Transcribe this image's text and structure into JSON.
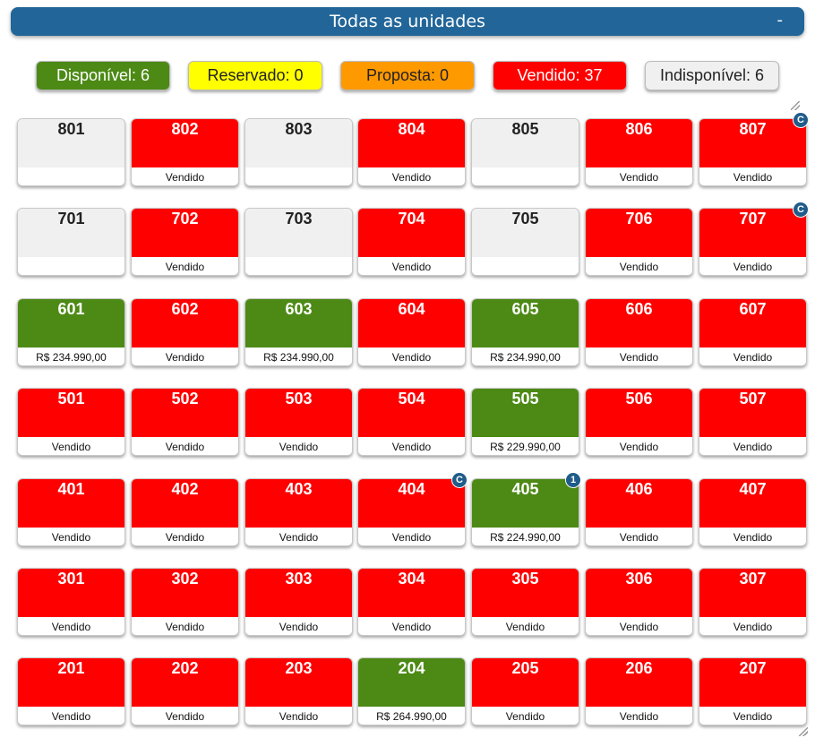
{
  "header": {
    "title": "Todas as unidades",
    "collapse_label": "-"
  },
  "colors": {
    "header": "#226699",
    "disponivel": "#4c8a15",
    "reservado": "#ffff00",
    "proposta": "#ff9900",
    "vendido": "#ff0000",
    "indisponivel": "#f0f0f0",
    "badge": "#1f5c8a"
  },
  "legend": [
    {
      "key": "disponivel",
      "label": "Disponível: 6"
    },
    {
      "key": "reservado",
      "label": "Reservado: 0"
    },
    {
      "key": "proposta",
      "label": "Proposta: 0"
    },
    {
      "key": "vendido",
      "label": "Vendido: 37"
    },
    {
      "key": "indisponivel",
      "label": "Indisponível: 6"
    }
  ],
  "floors": [
    {
      "units": [
        {
          "number": "801",
          "status": "indisponivel",
          "label": ""
        },
        {
          "number": "802",
          "status": "vendido",
          "label": "Vendido"
        },
        {
          "number": "803",
          "status": "indisponivel",
          "label": ""
        },
        {
          "number": "804",
          "status": "vendido",
          "label": "Vendido"
        },
        {
          "number": "805",
          "status": "indisponivel",
          "label": ""
        },
        {
          "number": "806",
          "status": "vendido",
          "label": "Vendido"
        },
        {
          "number": "807",
          "status": "vendido",
          "label": "Vendido",
          "badge": "C"
        }
      ]
    },
    {
      "units": [
        {
          "number": "701",
          "status": "indisponivel",
          "label": ""
        },
        {
          "number": "702",
          "status": "vendido",
          "label": "Vendido"
        },
        {
          "number": "703",
          "status": "indisponivel",
          "label": ""
        },
        {
          "number": "704",
          "status": "vendido",
          "label": "Vendido"
        },
        {
          "number": "705",
          "status": "indisponivel",
          "label": ""
        },
        {
          "number": "706",
          "status": "vendido",
          "label": "Vendido"
        },
        {
          "number": "707",
          "status": "vendido",
          "label": "Vendido",
          "badge": "C"
        }
      ]
    },
    {
      "units": [
        {
          "number": "601",
          "status": "disponivel",
          "label": "R$ 234.990,00"
        },
        {
          "number": "602",
          "status": "vendido",
          "label": "Vendido"
        },
        {
          "number": "603",
          "status": "disponivel",
          "label": "R$ 234.990,00"
        },
        {
          "number": "604",
          "status": "vendido",
          "label": "Vendido"
        },
        {
          "number": "605",
          "status": "disponivel",
          "label": "R$ 234.990,00"
        },
        {
          "number": "606",
          "status": "vendido",
          "label": "Vendido"
        },
        {
          "number": "607",
          "status": "vendido",
          "label": "Vendido"
        }
      ]
    },
    {
      "units": [
        {
          "number": "501",
          "status": "vendido",
          "label": "Vendido"
        },
        {
          "number": "502",
          "status": "vendido",
          "label": "Vendido"
        },
        {
          "number": "503",
          "status": "vendido",
          "label": "Vendido"
        },
        {
          "number": "504",
          "status": "vendido",
          "label": "Vendido"
        },
        {
          "number": "505",
          "status": "disponivel",
          "label": "R$ 229.990,00"
        },
        {
          "number": "506",
          "status": "vendido",
          "label": "Vendido"
        },
        {
          "number": "507",
          "status": "vendido",
          "label": "Vendido"
        }
      ]
    },
    {
      "units": [
        {
          "number": "401",
          "status": "vendido",
          "label": "Vendido"
        },
        {
          "number": "402",
          "status": "vendido",
          "label": "Vendido"
        },
        {
          "number": "403",
          "status": "vendido",
          "label": "Vendido"
        },
        {
          "number": "404",
          "status": "vendido",
          "label": "Vendido",
          "badge": "C"
        },
        {
          "number": "405",
          "status": "disponivel",
          "label": "R$ 224.990,00",
          "badge": "1"
        },
        {
          "number": "406",
          "status": "vendido",
          "label": "Vendido"
        },
        {
          "number": "407",
          "status": "vendido",
          "label": "Vendido"
        }
      ]
    },
    {
      "units": [
        {
          "number": "301",
          "status": "vendido",
          "label": "Vendido"
        },
        {
          "number": "302",
          "status": "vendido",
          "label": "Vendido"
        },
        {
          "number": "303",
          "status": "vendido",
          "label": "Vendido"
        },
        {
          "number": "304",
          "status": "vendido",
          "label": "Vendido"
        },
        {
          "number": "305",
          "status": "vendido",
          "label": "Vendido"
        },
        {
          "number": "306",
          "status": "vendido",
          "label": "Vendido"
        },
        {
          "number": "307",
          "status": "vendido",
          "label": "Vendido"
        }
      ]
    },
    {
      "units": [
        {
          "number": "201",
          "status": "vendido",
          "label": "Vendido"
        },
        {
          "number": "202",
          "status": "vendido",
          "label": "Vendido"
        },
        {
          "number": "203",
          "status": "vendido",
          "label": "Vendido"
        },
        {
          "number": "204",
          "status": "disponivel",
          "label": "R$ 264.990,00"
        },
        {
          "number": "205",
          "status": "vendido",
          "label": "Vendido"
        },
        {
          "number": "206",
          "status": "vendido",
          "label": "Vendido"
        },
        {
          "number": "207",
          "status": "vendido",
          "label": "Vendido"
        }
      ]
    }
  ]
}
